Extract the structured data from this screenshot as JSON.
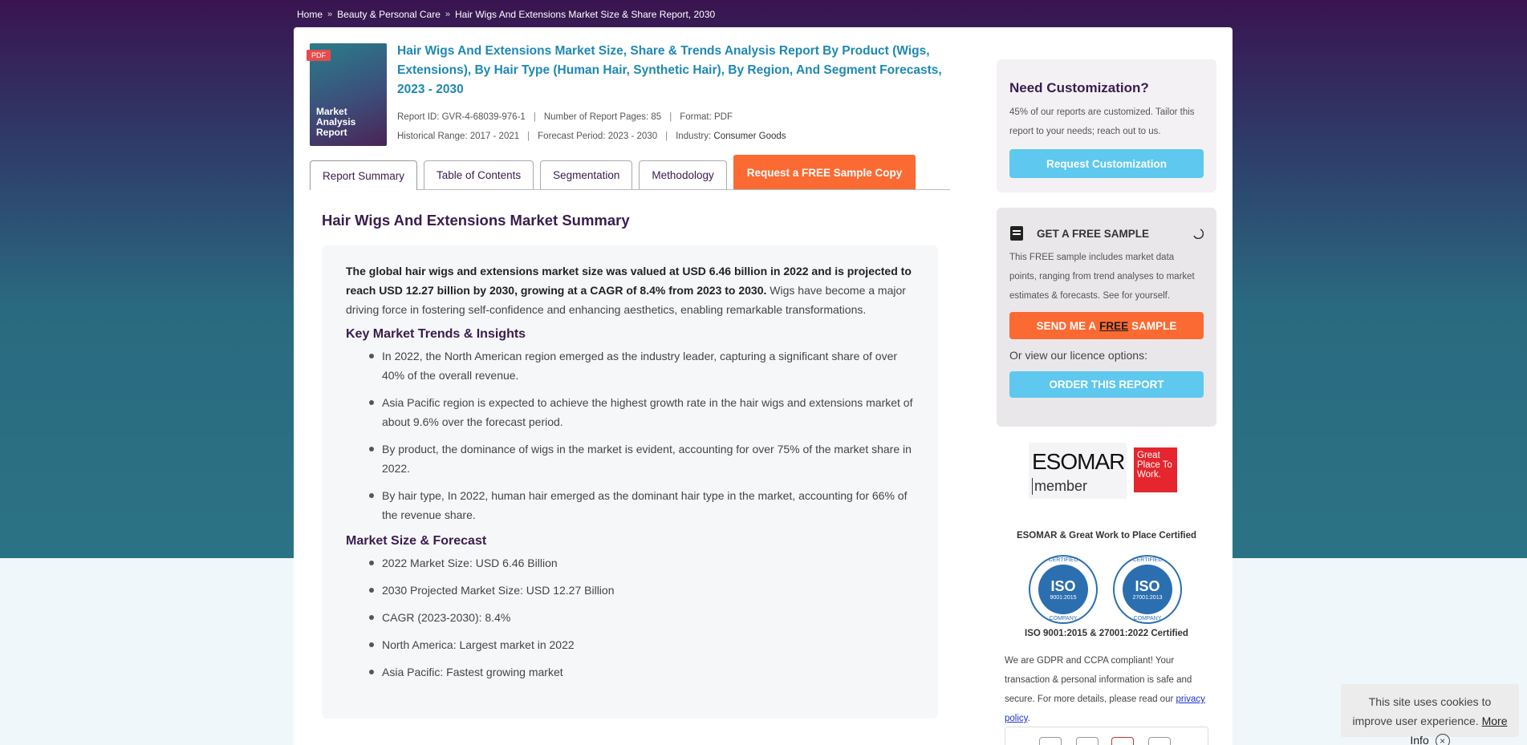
{
  "breadcrumb": {
    "items": [
      "Home",
      "Beauty & Personal Care",
      "Hair Wigs And Extensions Market Size & Share Report, 2030"
    ],
    "separator": "»"
  },
  "report": {
    "pdf_tag": "PDF",
    "cover_title": "Market Analysis Report",
    "title": "Hair Wigs And Extensions Market Size, Share & Trends Analysis Report By Product (Wigs, Extensions), By Hair Type (Human Hair, Synthetic Hair), By Region, And Segment Forecasts, 2023 - 2030",
    "report_id": "Report ID: GVR-4-68039-976-1",
    "pages": "Number of Report Pages: 85",
    "format": "Format: PDF",
    "historical": "Historical Range: 2017 - 2021",
    "forecast": "Forecast Period: 2023 - 2030",
    "industry_label": "Industry:",
    "industry_value": "Consumer Goods"
  },
  "tabs": {
    "summary": "Report Summary",
    "toc": "Table of Contents",
    "segmentation": "Segmentation",
    "methodology": "Methodology",
    "sample": "Request a FREE Sample Copy"
  },
  "summary": {
    "heading": "Hair Wigs And Extensions Market Summary",
    "lead_bold": "The global hair wigs and extensions market size was valued at USD 6.46 billion in 2022 and is projected to reach USD 12.27 billion by 2030, growing at a CAGR of 8.4% from 2023 to 2030.",
    "lead_rest": " Wigs have become a major driving force in fostering self-confidence and enhancing aesthetics, enabling remarkable transformations.",
    "trends_heading": "Key Market Trends & Insights",
    "trends": [
      "In 2022, the North American region emerged as the industry leader, capturing a significant share of over 40% of the overall revenue.",
      "Asia Pacific region is expected to achieve the highest growth rate in the hair wigs and extensions market of about 9.6% over the forecast period.",
      "By product, the dominance of wigs in the market is evident, accounting for over 75% of the market share in 2022.",
      "By hair type, In 2022, human hair emerged as the dominant hair type in the market, accounting for 66% of the revenue share."
    ],
    "forecast_heading": "Market Size & Forecast",
    "forecast_items": [
      "2022 Market Size: USD 6.46 Billion",
      "2030 Projected Market Size: USD 12.27 Billion",
      "CAGR (2023-2030): 8.4%",
      "North America: Largest market in 2022",
      "Asia Pacific: Fastest growing market"
    ]
  },
  "sidebar": {
    "custom_title": "Need Customization?",
    "custom_text": "45% of our reports are customized. Tailor this report to your needs; reach out to us.",
    "custom_button": "Request Customization",
    "sample_title": "GET A FREE SAMPLE",
    "sample_text": "This FREE sample includes market data points, ranging from trend analyses to market estimates & forecasts. See for yourself.",
    "sample_button_pre": "SEND ME A",
    "sample_button_free": "FREE",
    "sample_button_post": "SAMPLE",
    "licence_text": "Or view our licence options:",
    "order_button": "ORDER THIS REPORT",
    "esomar_big": "ESOMAR",
    "esomar_small": "member",
    "gptw": "Great Place To Work.",
    "cert1_caption": "ESOMAR & Great Work to Place Certified",
    "iso_ring_top": "CERTIFIED",
    "iso_ring_bottom": "COMPANY",
    "iso_text": "ISO",
    "iso1_code": "9001:2015",
    "iso2_code": "27001:2013",
    "cert2_caption": "ISO 9001:2015 & 27001:2022 Certified",
    "gdpr_text": "We are GDPR and CCPA compliant! Your transaction & personal information is safe and secure. For more details, please read our ",
    "gdpr_link": "privacy policy",
    "gdpr_end": "."
  },
  "cookie": {
    "text": "This site uses cookies to improve user experience.",
    "link": "More Info",
    "close": "×"
  },
  "colors": {
    "accent_orange": "#fb6a32",
    "accent_blue": "#5ec8ee",
    "title_blue": "#1e88b4",
    "heading_purple": "#3a1c4f"
  }
}
